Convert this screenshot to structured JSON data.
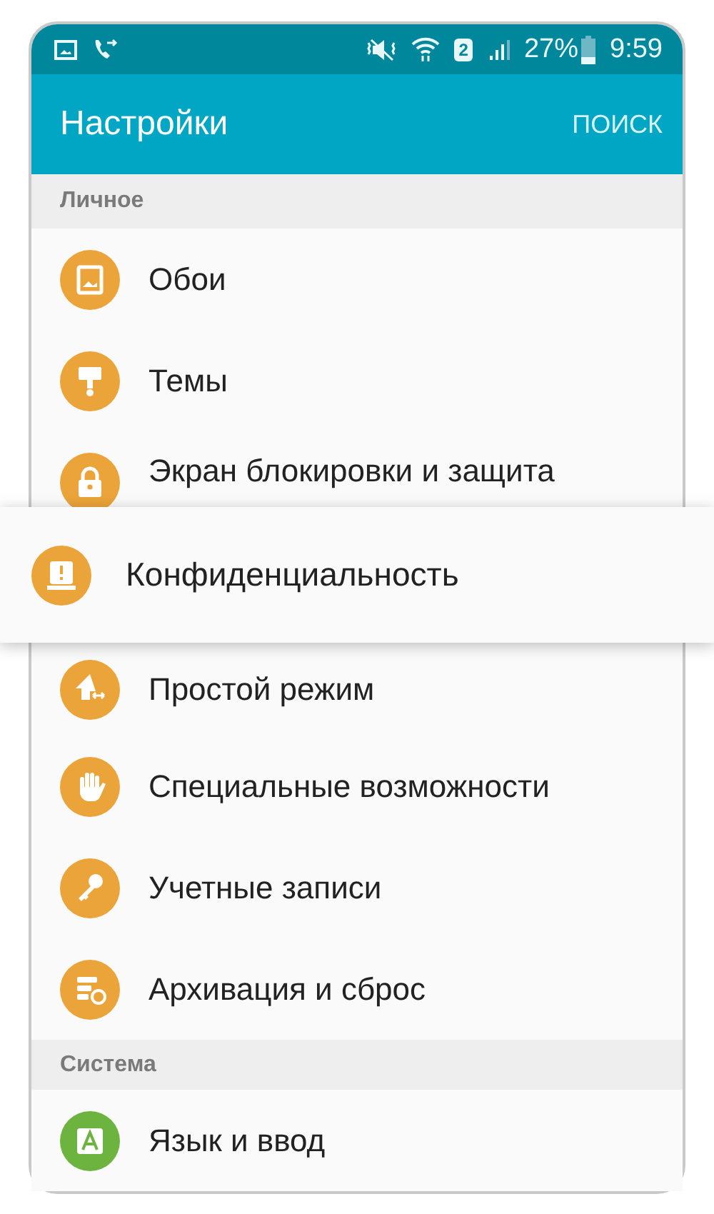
{
  "status_bar": {
    "sim": "2",
    "battery": "27%",
    "time": "9:59"
  },
  "app_bar": {
    "title": "Настройки",
    "action": "ПОИСК"
  },
  "sections": [
    {
      "title": "Личное",
      "items": [
        {
          "label": "Обои",
          "color": "#eba43a",
          "highlighted": false
        },
        {
          "label": "Темы",
          "color": "#eba43a",
          "highlighted": false
        },
        {
          "label": "Экран блокировки и защита",
          "color": "#eba43a",
          "highlighted": false
        },
        {
          "label": "Конфиденциальность",
          "color": "#eba43a",
          "highlighted": true
        },
        {
          "label": "Простой режим",
          "color": "#eba43a",
          "highlighted": false
        },
        {
          "label": "Специальные возможности",
          "color": "#eba43a",
          "highlighted": false
        },
        {
          "label": "Учетные записи",
          "color": "#eba43a",
          "highlighted": false
        },
        {
          "label": "Архивация и сброс",
          "color": "#eba43a",
          "highlighted": false
        }
      ]
    },
    {
      "title": "Система",
      "items": [
        {
          "label": "Язык и ввод",
          "color": "#6db33f",
          "highlighted": false
        }
      ]
    }
  ]
}
